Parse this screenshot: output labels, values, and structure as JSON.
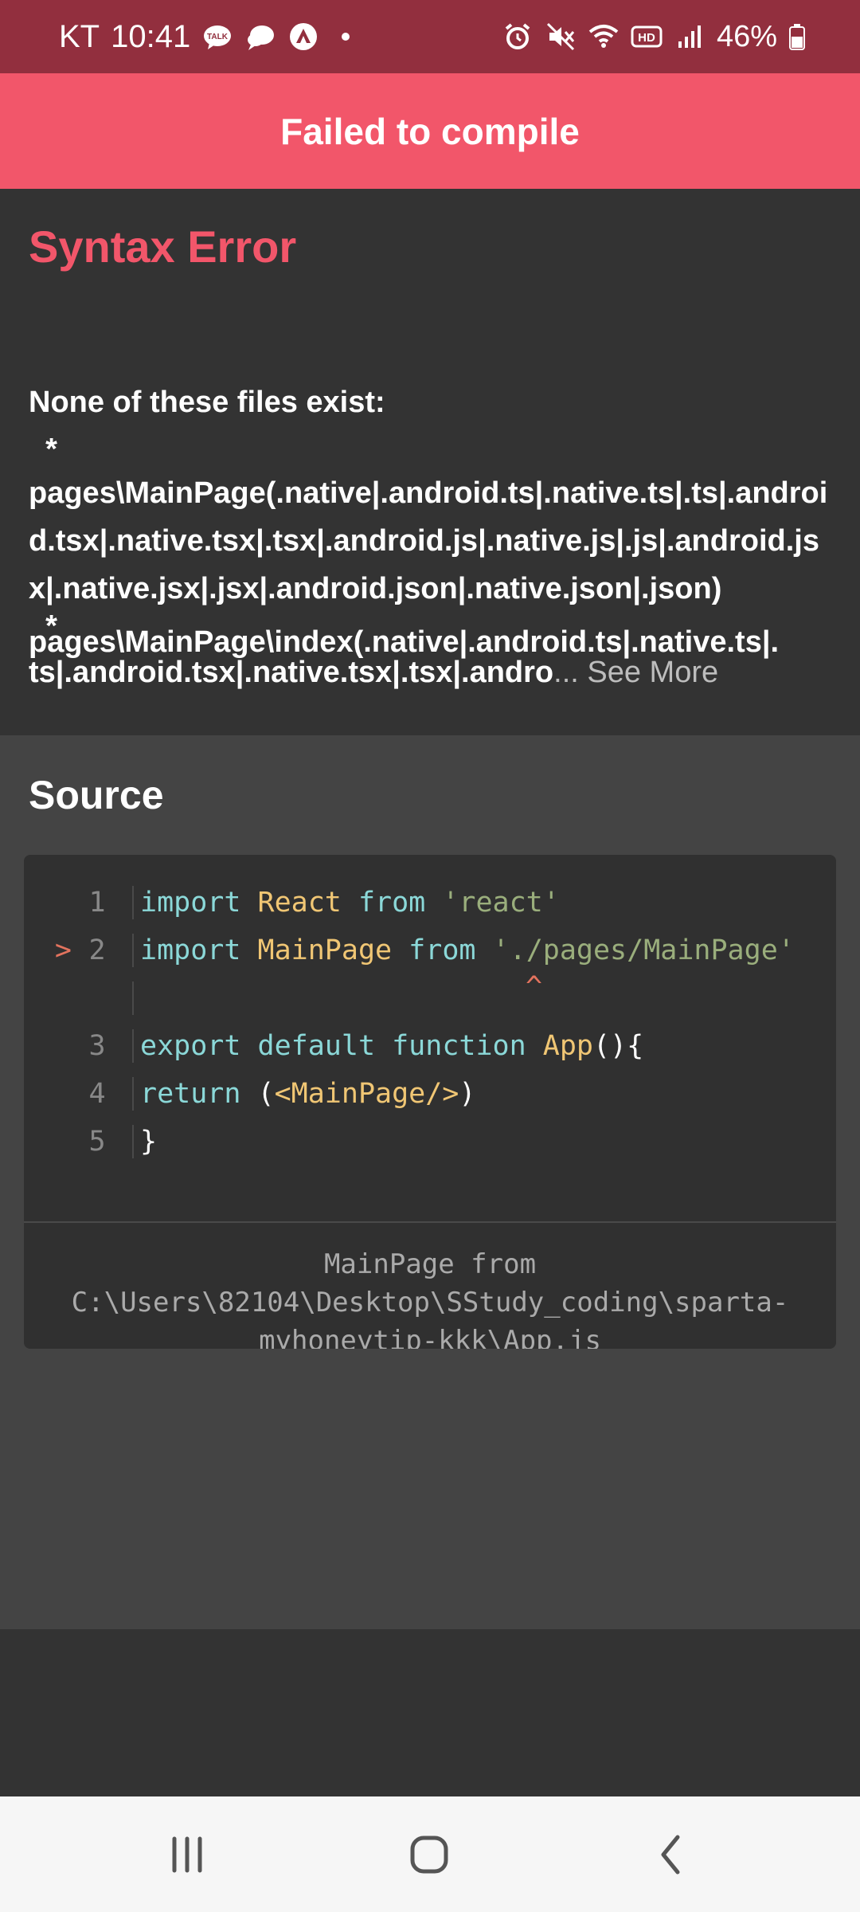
{
  "status_bar": {
    "carrier": "KT",
    "time": "10:41",
    "battery": "46%",
    "left_icons": [
      "talk-icon",
      "chat-bubble-icon",
      "expo-icon"
    ],
    "right_icons": [
      "alarm-icon",
      "mute-icon",
      "wifi-icon",
      "hd-icon",
      "signal-icon",
      "battery-icon"
    ],
    "background_color": "#922F3E"
  },
  "header": {
    "title": "Failed to compile",
    "background_color": "#F2566A"
  },
  "error": {
    "title": "Syntax Error",
    "message_heading": "None of these files exist:",
    "bullet_1": "  *",
    "paths_1": "pages\\MainPage(.native|.android.ts|.native.ts|.ts|.android.tsx|.native.tsx|.tsx|.android.js|.native.js|.js|.android.jsx|.native.jsx|.jsx|.android.json|.native.json|.json)",
    "bullet_2": "  *",
    "paths_2_line_a": "pages\\MainPage\\index(.native|.android.ts|.native.ts|.",
    "paths_2_line_b": "ts|.android.tsx|.native.tsx|.tsx|.andro",
    "ellipsis": "...",
    "see_more": " See More",
    "title_color": "#F2566A"
  },
  "source": {
    "title": "Source",
    "lines": [
      {
        "marker": "",
        "num": "1",
        "tokens": [
          "import",
          "React",
          "from",
          "'react'"
        ]
      },
      {
        "marker": ">",
        "num": "2",
        "tokens": [
          "import",
          "MainPage",
          "from",
          "'./pages/MainPage'"
        ]
      },
      {
        "marker": "",
        "num": "",
        "caret": "^"
      },
      {
        "marker": "",
        "num": "3",
        "tokens": [
          "export",
          "default",
          "function",
          "App",
          "(){"
        ]
      },
      {
        "marker": "",
        "num": "4",
        "tokens": [
          "return",
          "(",
          "<MainPage/>",
          ")"
        ]
      },
      {
        "marker": "",
        "num": "5",
        "tokens": [
          "}"
        ]
      }
    ],
    "footer_line_1": "MainPage from",
    "footer_line_2": "C:\\Users\\82104\\Desktop\\SStudy_coding\\sparta-",
    "footer_line_3": "myhoneytip-kkk\\App.js"
  },
  "nav_bar": {
    "buttons": [
      "recent-apps-icon",
      "home-icon",
      "back-icon"
    ]
  }
}
